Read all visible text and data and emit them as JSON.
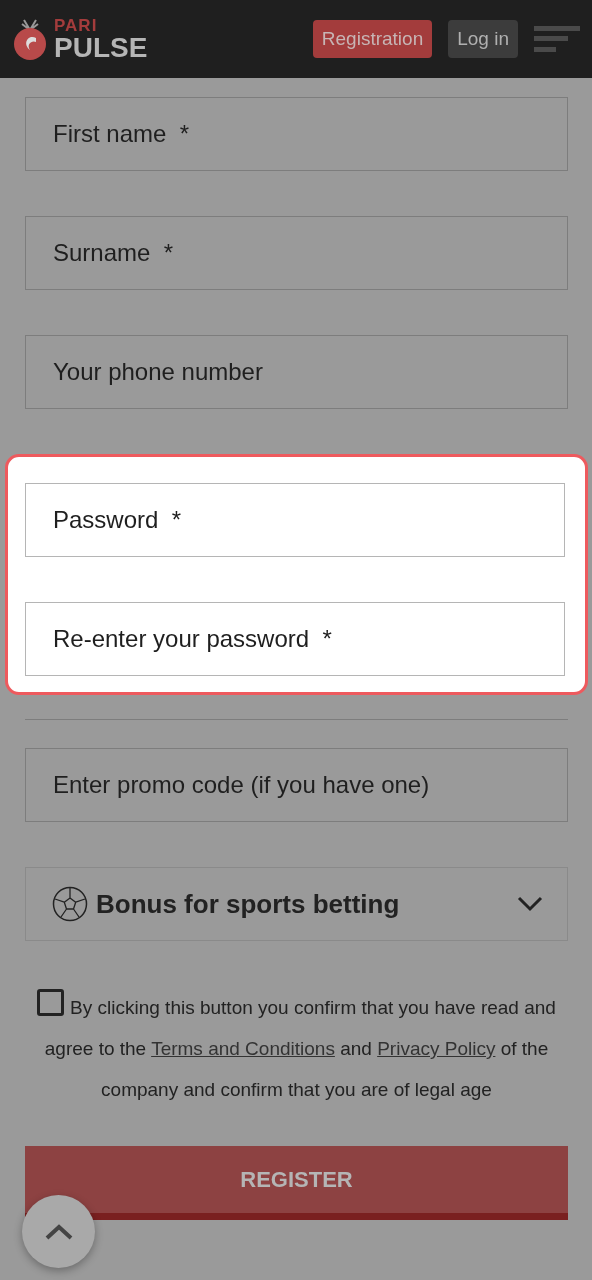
{
  "header": {
    "logo_top": "PARI",
    "logo_bottom": "PULSE",
    "buttons": [
      {
        "label": "Registration",
        "kind": "primary"
      },
      {
        "label": "Log in",
        "kind": "secondary"
      }
    ]
  },
  "fields": [
    {
      "placeholder": "First name  *"
    },
    {
      "placeholder": "Surname  *"
    },
    {
      "placeholder": "Your phone number"
    }
  ],
  "password_fields": [
    {
      "placeholder": "Password  *"
    },
    {
      "placeholder": "Re-enter your password  *"
    }
  ],
  "promo_field": {
    "placeholder": "Enter promo code (if you have one)"
  },
  "bonus": {
    "label": "Bonus for sports betting",
    "expanded": false
  },
  "consent": {
    "checked": false,
    "parts": [
      {
        "kind": "text",
        "text": "By clicking this button you confirm that you have read and agree to the "
      },
      {
        "kind": "link",
        "text": "Terms and Conditions"
      },
      {
        "kind": "text",
        "text": " and "
      },
      {
        "kind": "link",
        "text": "Privacy Policy"
      },
      {
        "kind": "text",
        "text": " of the company and confirm that you are of legal age"
      }
    ]
  },
  "register_button": {
    "label": "REGISTER"
  }
}
